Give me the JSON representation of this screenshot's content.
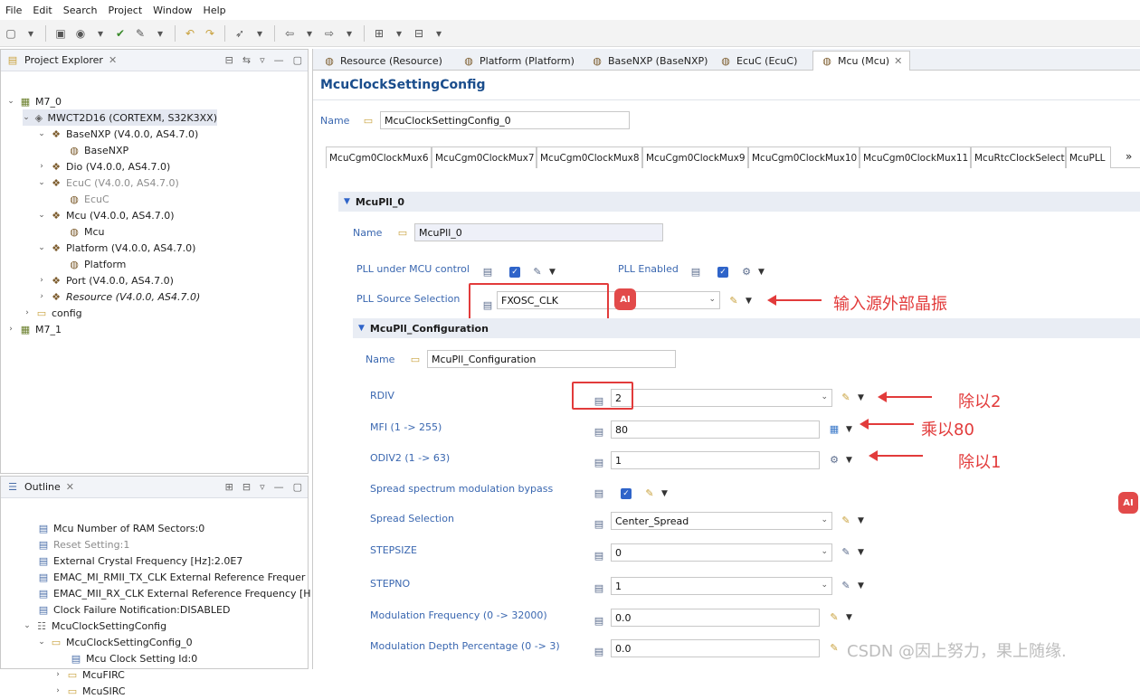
{
  "menu": [
    "File",
    "Edit",
    "Search",
    "Project",
    "Window",
    "Help"
  ],
  "project_explorer": {
    "title": "Project Explorer",
    "items": [
      {
        "label": "M7_0"
      },
      {
        "label": "MWCT2D16 (CORTEXM, S32K3XX)"
      },
      {
        "label": "BaseNXP (V4.0.0, AS4.7.0)"
      },
      {
        "label": "BaseNXP"
      },
      {
        "label": "Dio (V4.0.0, AS4.7.0)"
      },
      {
        "label": "EcuC (V4.0.0, AS4.7.0)"
      },
      {
        "label": "EcuC"
      },
      {
        "label": "Mcu (V4.0.0, AS4.7.0)"
      },
      {
        "label": "Mcu"
      },
      {
        "label": "Platform (V4.0.0, AS4.7.0)"
      },
      {
        "label": "Platform"
      },
      {
        "label": "Port (V4.0.0, AS4.7.0)"
      },
      {
        "label": "Resource (V4.0.0, AS4.7.0)"
      },
      {
        "label": "config"
      },
      {
        "label": "M7_1"
      }
    ]
  },
  "outline": {
    "title": "Outline",
    "items": [
      {
        "label": "Mcu Number of RAM Sectors:0"
      },
      {
        "label": "Reset Setting:1"
      },
      {
        "label": "External Crystal Frequency [Hz]:2.0E7"
      },
      {
        "label": "EMAC_MI_RMII_TX_CLK External Reference Frequer"
      },
      {
        "label": "EMAC_MII_RX_CLK External Reference Frequency [H"
      },
      {
        "label": "Clock Failure Notification:DISABLED"
      },
      {
        "label": "McuClockSettingConfig"
      },
      {
        "label": "McuClockSettingConfig_0"
      },
      {
        "label": "Mcu Clock Setting Id:0"
      },
      {
        "label": "McuFIRC"
      },
      {
        "label": "McuSIRC"
      }
    ]
  },
  "editor_tabs": [
    {
      "label": "Resource (Resource)"
    },
    {
      "label": "Platform (Platform)"
    },
    {
      "label": "BaseNXP (BaseNXP)"
    },
    {
      "label": "EcuC (EcuC)"
    },
    {
      "label": "Mcu (Mcu)"
    }
  ],
  "editor": {
    "title": "McuClockSettingConfig",
    "name_label": "Name",
    "name_value": "McuClockSettingConfig_0",
    "subtabs": [
      "McuCgm0ClockMux6",
      "McuCgm0ClockMux7",
      "McuCgm0ClockMux8",
      "McuCgm0ClockMux9",
      "McuCgm0ClockMux10",
      "McuCgm0ClockMux11",
      "McuRtcClockSelect",
      "McuPLL"
    ],
    "subtabs_more": "»",
    "pll_section": "McuPll_0",
    "pll_name_label": "Name",
    "pll_name_value": "McuPll_0",
    "pll_under_mcu_label": "PLL under MCU control",
    "pll_enabled_label": "PLL Enabled",
    "pll_source_label": "PLL Source Selection",
    "pll_source_value": "FXOSC_CLK",
    "config_section": "McuPll_Configuration",
    "config_name_label": "Name",
    "config_name_value": "McuPll_Configuration",
    "params": [
      {
        "label": "RDIV",
        "value": "2"
      },
      {
        "label": "MFI (1 -> 255)",
        "value": "80"
      },
      {
        "label": "ODIV2 (1 -> 63)",
        "value": "1"
      },
      {
        "label": "Spread spectrum modulation bypass",
        "value": ""
      },
      {
        "label": "Spread Selection",
        "value": "Center_Spread"
      },
      {
        "label": "STEPSIZE",
        "value": "0"
      },
      {
        "label": "STEPNO",
        "value": "1"
      },
      {
        "label": "Modulation Frequency (0 -> 32000)",
        "value": "0.0"
      },
      {
        "label": "Modulation Depth Percentage (0 -> 3)",
        "value": "0.0"
      }
    ]
  },
  "annotations": {
    "source": "输入源外部晶振",
    "rdiv": "除以2",
    "mfi": "乘以80",
    "odiv": "除以1"
  },
  "ai_badge": "AI",
  "watermark": "CSDN @因上努力，果上随缘."
}
